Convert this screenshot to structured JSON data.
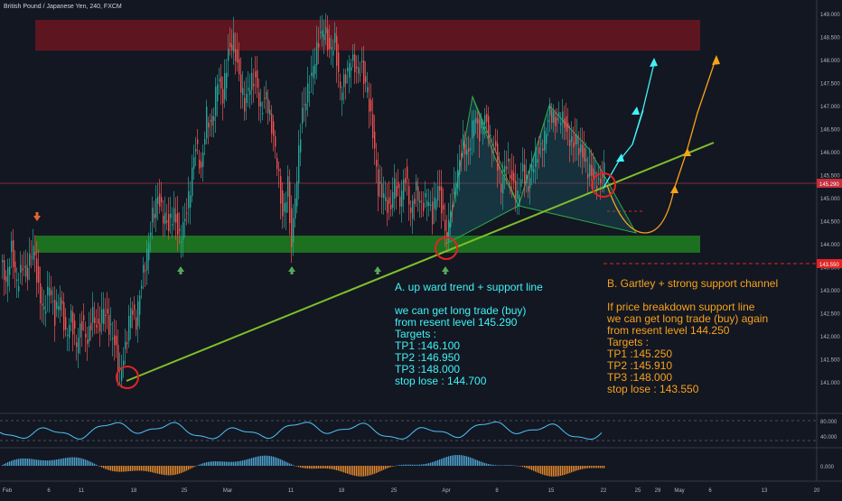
{
  "header": {
    "symbol_title": "British Pound / Japanese Yen, 240, FXCM"
  },
  "colors": {
    "background": "#131722",
    "cyan": "#3ff3f7",
    "orange": "#f7a21b",
    "trendline": "#7fbf2a",
    "resistance_zone": "#6b1520",
    "support_zone": "#1f7a1f",
    "price_line": "#a5364a",
    "marker_circle": "#e02424",
    "up_arrow": "#57a85a",
    "down_arrow": "#e8632f",
    "price_label_current": "#c62d3a",
    "price_label_stop": "#e02424"
  },
  "chart_data": {
    "type": "candlestick",
    "title": "British Pound / Japanese Yen, 240, FXCM",
    "ylim": [
      140.0,
      149.0
    ],
    "y_ticks": [
      "149.000",
      "148.500",
      "148.000",
      "147.500",
      "147.000",
      "146.500",
      "146.000",
      "145.500",
      "145.000",
      "144.500",
      "144.000",
      "143.500",
      "143.000",
      "142.500",
      "142.000",
      "141.500",
      "141.000"
    ],
    "x_ticks": [
      "Feb",
      "6",
      "11",
      "18",
      "25",
      "Mar",
      "11",
      "18",
      "25",
      "Apr",
      "8",
      "15",
      "22",
      "25",
      "29",
      "May",
      "6",
      "13",
      "20"
    ],
    "price_labels": {
      "current": "145.290",
      "stop": "143.550"
    },
    "price_path": [
      [
        0,
        143.6
      ],
      [
        6,
        143.2
      ],
      [
        12,
        143.9
      ],
      [
        18,
        143.1
      ],
      [
        24,
        143.5
      ],
      [
        30,
        143.4
      ],
      [
        36,
        144.0
      ],
      [
        42,
        143.0
      ],
      [
        48,
        142.5
      ],
      [
        54,
        143.1
      ],
      [
        60,
        142.4
      ],
      [
        66,
        142.9
      ],
      [
        72,
        142.0
      ],
      [
        78,
        142.4
      ],
      [
        84,
        141.8
      ],
      [
        90,
        142.3
      ],
      [
        96,
        141.9
      ],
      [
        102,
        142.5
      ],
      [
        108,
        142.1
      ],
      [
        114,
        142.6
      ],
      [
        120,
        142.2
      ],
      [
        126,
        141.9
      ],
      [
        132,
        141.2
      ],
      [
        138,
        141.7
      ],
      [
        144,
        142.6
      ],
      [
        150,
        142.3
      ],
      [
        156,
        143.2
      ],
      [
        162,
        143.8
      ],
      [
        168,
        144.6
      ],
      [
        174,
        145.0
      ],
      [
        180,
        144.6
      ],
      [
        186,
        144.4
      ],
      [
        192,
        144.7
      ],
      [
        198,
        144.1
      ],
      [
        204,
        144.5
      ],
      [
        210,
        145.2
      ],
      [
        216,
        146.2
      ],
      [
        222,
        145.6
      ],
      [
        228,
        146.8
      ],
      [
        234,
        146.5
      ],
      [
        240,
        147.6
      ],
      [
        246,
        147.2
      ],
      [
        252,
        148.2
      ],
      [
        258,
        148.4
      ],
      [
        264,
        147.6
      ],
      [
        270,
        147.0
      ],
      [
        276,
        147.5
      ],
      [
        282,
        147.6
      ],
      [
        288,
        146.9
      ],
      [
        294,
        147.2
      ],
      [
        300,
        146.5
      ],
      [
        306,
        145.8
      ],
      [
        312,
        144.6
      ],
      [
        318,
        145.3
      ],
      [
        322,
        143.9
      ],
      [
        328,
        145.5
      ],
      [
        334,
        146.9
      ],
      [
        340,
        147.3
      ],
      [
        346,
        147.8
      ],
      [
        352,
        148.4
      ],
      [
        358,
        148.7
      ],
      [
        364,
        148.2
      ],
      [
        370,
        148.4
      ],
      [
        376,
        147.3
      ],
      [
        382,
        147.6
      ],
      [
        388,
        148.0
      ],
      [
        394,
        147.8
      ],
      [
        400,
        147.8
      ],
      [
        406,
        147.3
      ],
      [
        412,
        146.4
      ],
      [
        418,
        145.2
      ],
      [
        424,
        145.1
      ],
      [
        430,
        144.7
      ],
      [
        436,
        145.3
      ],
      [
        442,
        144.9
      ],
      [
        448,
        145.5
      ],
      [
        454,
        144.7
      ],
      [
        460,
        145.2
      ],
      [
        466,
        144.8
      ],
      [
        472,
        145.0
      ],
      [
        478,
        144.6
      ],
      [
        484,
        145.3
      ],
      [
        490,
        144.6
      ],
      [
        494,
        144.2
      ],
      [
        500,
        144.9
      ],
      [
        506,
        145.6
      ],
      [
        512,
        146.2
      ],
      [
        518,
        145.9
      ],
      [
        524,
        146.8
      ],
      [
        530,
        146.4
      ],
      [
        536,
        146.8
      ],
      [
        542,
        146.2
      ],
      [
        548,
        146.0
      ],
      [
        554,
        145.2
      ],
      [
        560,
        145.8
      ],
      [
        566,
        145.4
      ],
      [
        572,
        145.0
      ],
      [
        578,
        145.6
      ],
      [
        584,
        145.2
      ],
      [
        590,
        145.8
      ],
      [
        596,
        146.0
      ],
      [
        602,
        146.3
      ],
      [
        608,
        146.9
      ],
      [
        614,
        146.6
      ],
      [
        620,
        146.8
      ],
      [
        626,
        146.5
      ],
      [
        632,
        146.2
      ],
      [
        638,
        146.2
      ],
      [
        644,
        145.9
      ],
      [
        650,
        145.6
      ],
      [
        656,
        145.5
      ],
      [
        662,
        145.3
      ],
      [
        668,
        145.6
      ]
    ],
    "zones": [
      {
        "name": "resistance",
        "y_low": 148.2,
        "y_high": 148.9
      },
      {
        "name": "support",
        "y_low": 143.9,
        "y_high": 144.2
      }
    ],
    "trendline": {
      "from": [
        141.0,
        0.155
      ],
      "to": [
        146.2,
        0.85
      ]
    },
    "projection_cyan": [
      [
        145.6
      ],
      [
        146.7
      ],
      [
        147.4
      ],
      [
        148.1
      ]
    ],
    "indicators": {
      "rsi_ticks": [
        "80.000",
        "40.000"
      ],
      "macd_ticks": [
        "0.000"
      ]
    }
  },
  "annotations": {
    "a": {
      "heading": "A.  up ward trend + support line",
      "lines": [
        "we can get long trade (buy)",
        "from resent level 145.290",
        "Targets :",
        "TP1 :146.100",
        "TP2 :146.950",
        "TP3 :148.000",
        "stop lose : 144.700"
      ]
    },
    "b": {
      "heading": "B.  Gartley + strong support channel",
      "lines": [
        "If price breakdown support line",
        "we can get long trade (buy) again",
        "from resent level 144.250",
        "Targets :",
        "TP1 :145.250",
        "TP2 :145.910",
        "TP3 :148.000",
        "stop lose : 143.550"
      ]
    }
  }
}
